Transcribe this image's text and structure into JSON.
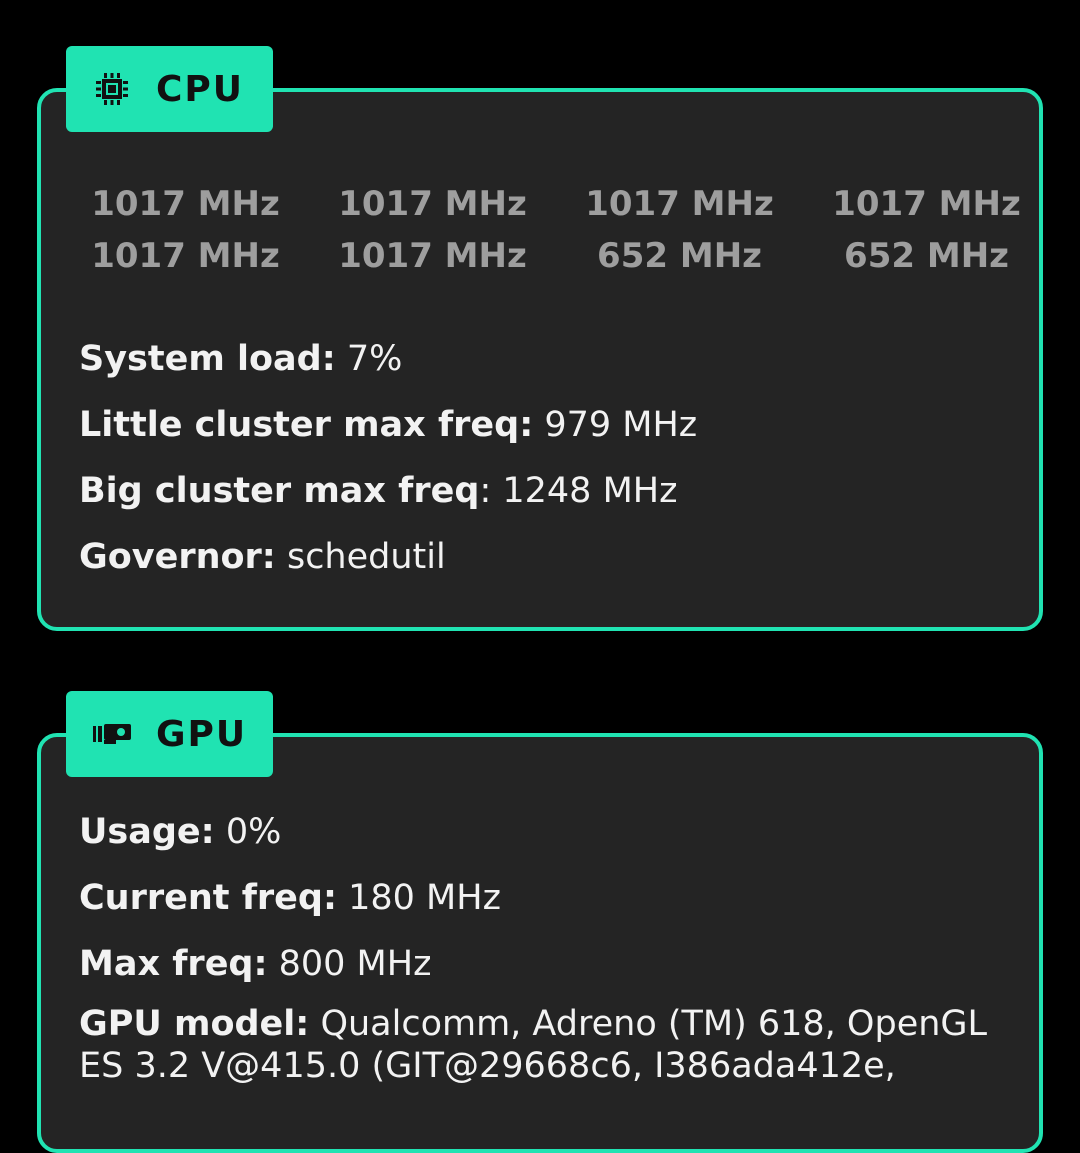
{
  "accent_color": "#20e3b2",
  "cpu": {
    "title": "CPU",
    "icon": "cpu-chip-icon",
    "core_freqs": [
      "1017 MHz",
      "1017 MHz",
      "1017 MHz",
      "1017 MHz",
      "1017 MHz",
      "1017 MHz",
      "652 MHz",
      "652 MHz"
    ],
    "system_load_label": "System load:",
    "system_load_value": "7%",
    "little_max_label": "Little cluster max freq:",
    "little_max_value": "979 MHz",
    "big_max_label": "Big cluster max freq",
    "big_max_value": ": 1248 MHz",
    "governor_label": "Governor:",
    "governor_value": "schedutil"
  },
  "gpu": {
    "title": "GPU",
    "icon": "graphics-card-icon",
    "usage_label": "Usage:",
    "usage_value": "0%",
    "current_freq_label": "Current freq:",
    "current_freq_value": "180 MHz",
    "max_freq_label": "Max freq:",
    "max_freq_value": "800 MHz",
    "model_label": "GPU model:",
    "model_value": "Qualcomm, Adreno (TM) 618, OpenGL ES 3.2 V@415.0 (GIT@29668c6, I386ada412e,"
  }
}
